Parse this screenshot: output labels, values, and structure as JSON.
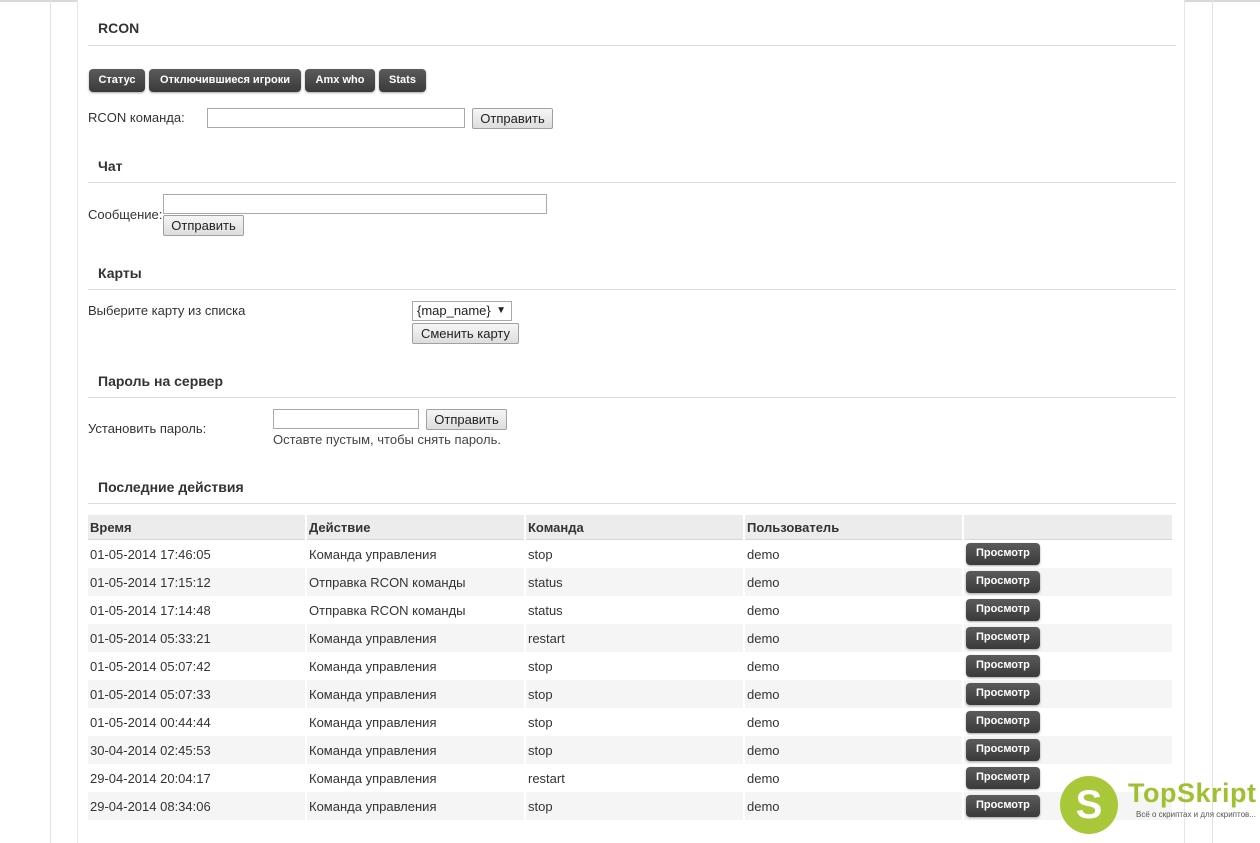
{
  "rcon": {
    "title": "RCON",
    "buttons": [
      "Статус",
      "Отключившиеся игроки",
      "Amx who",
      "Stats"
    ],
    "command_label": "RCON команда:",
    "command_value": "",
    "send_label": "Отправить"
  },
  "chat": {
    "title": "Чат",
    "message_label": "Сообщение:",
    "message_value": "",
    "send_label": "Отправить"
  },
  "maps": {
    "title": "Карты",
    "select_label": "Выберите карту из списка",
    "selected_map": "{map_name}",
    "change_label": "Сменить карту"
  },
  "password": {
    "title": "Пароль на сервер",
    "set_label": "Установить пароль:",
    "value": "",
    "send_label": "Отправить",
    "hint": "Оставте пустым, чтобы снять пароль."
  },
  "recent": {
    "title": "Последние действия",
    "columns": [
      "Время",
      "Действие",
      "Команда",
      "Пользователь",
      ""
    ],
    "view_label": "Просмотр",
    "rows": [
      {
        "time": "01-05-2014 17:46:05",
        "action": "Команда управления",
        "command": "stop",
        "user": "demo"
      },
      {
        "time": "01-05-2014 17:15:12",
        "action": "Отправка RCON команды",
        "command": "status",
        "user": "demo"
      },
      {
        "time": "01-05-2014 17:14:48",
        "action": "Отправка RCON команды",
        "command": "status",
        "user": "demo"
      },
      {
        "time": "01-05-2014 05:33:21",
        "action": "Команда управления",
        "command": "restart",
        "user": "demo"
      },
      {
        "time": "01-05-2014 05:07:42",
        "action": "Команда управления",
        "command": "stop",
        "user": "demo"
      },
      {
        "time": "01-05-2014 05:07:33",
        "action": "Команда управления",
        "command": "stop",
        "user": "demo"
      },
      {
        "time": "01-05-2014 00:44:44",
        "action": "Команда управления",
        "command": "stop",
        "user": "demo"
      },
      {
        "time": "30-04-2014 02:45:53",
        "action": "Команда управления",
        "command": "stop",
        "user": "demo"
      },
      {
        "time": "29-04-2014 20:04:17",
        "action": "Команда управления",
        "command": "restart",
        "user": "demo"
      },
      {
        "time": "29-04-2014 08:34:06",
        "action": "Команда управления",
        "command": "stop",
        "user": "demo"
      }
    ]
  },
  "watermark": {
    "letter": "S",
    "name": "TopSkript",
    "tagline": "Всё о скриптах и для скриптов..."
  },
  "colors": {
    "dark_button": "#4a4a4a",
    "logo_green": "#a8c83a"
  }
}
